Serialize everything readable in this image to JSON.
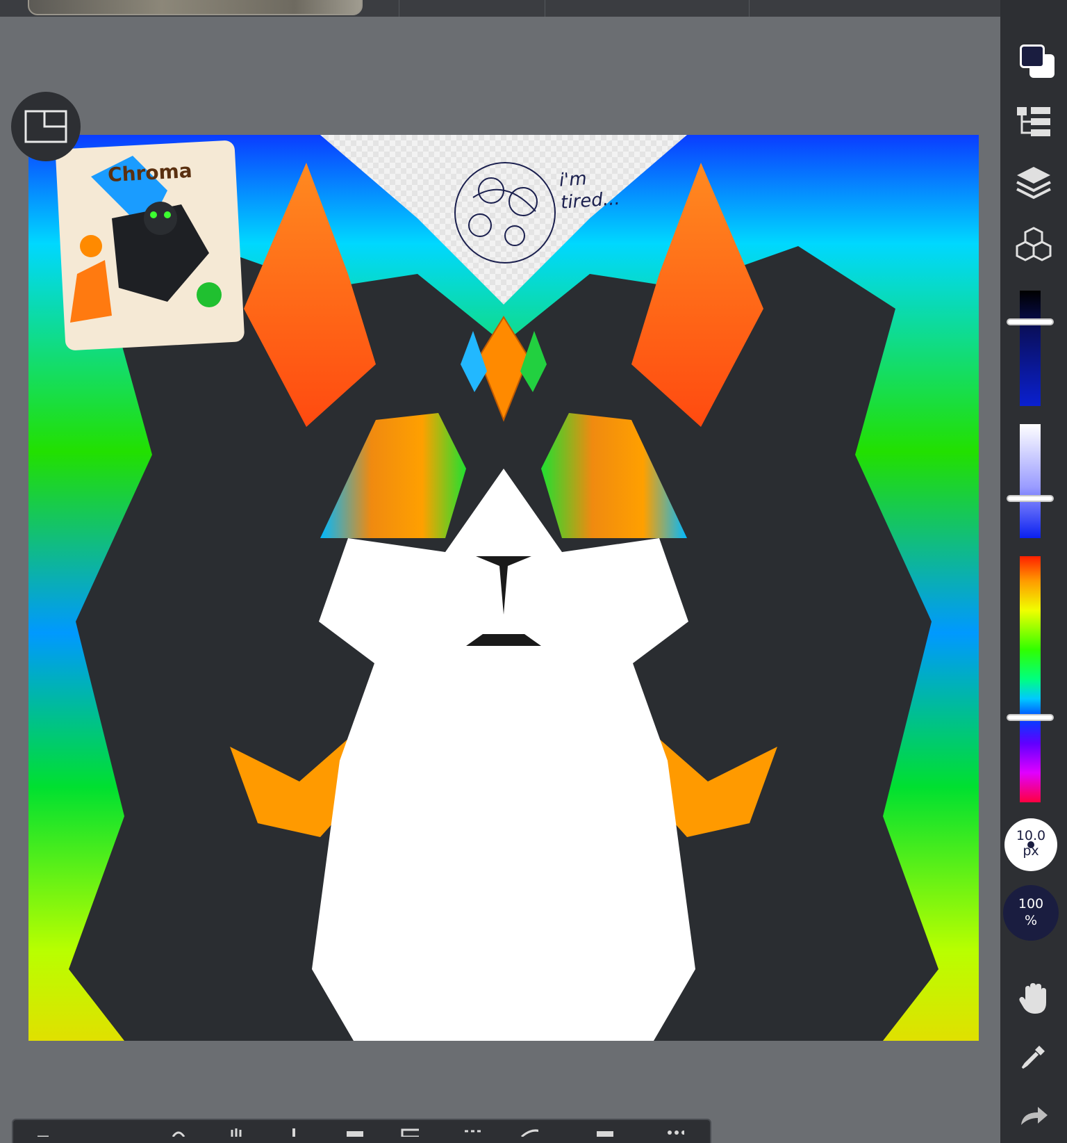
{
  "top_bar": {},
  "artwork": {
    "annotation": [
      "i'm",
      "tired..."
    ],
    "reference_label": "Chroma"
  },
  "sidebar": {
    "foreground_color": "#1a1d40",
    "background_color": "#ffffff",
    "brush_size": "10.0",
    "brush_size_unit": "px",
    "opacity": "100",
    "opacity_unit": "%"
  },
  "colors": {
    "ui_dark": "#2d2f33",
    "canvas_bg": "#6b6e72",
    "accent_navy": "#1a1d40"
  },
  "sliders": {
    "brightness_level": 0.27,
    "saturation_level": 0.65,
    "hue_level": 0.65
  },
  "icons": [
    "reference-window-icon",
    "layer-settings-icon",
    "layers-icon",
    "3d-cubes-icon",
    "hand-icon",
    "eyedropper-icon",
    "redo-icon"
  ]
}
